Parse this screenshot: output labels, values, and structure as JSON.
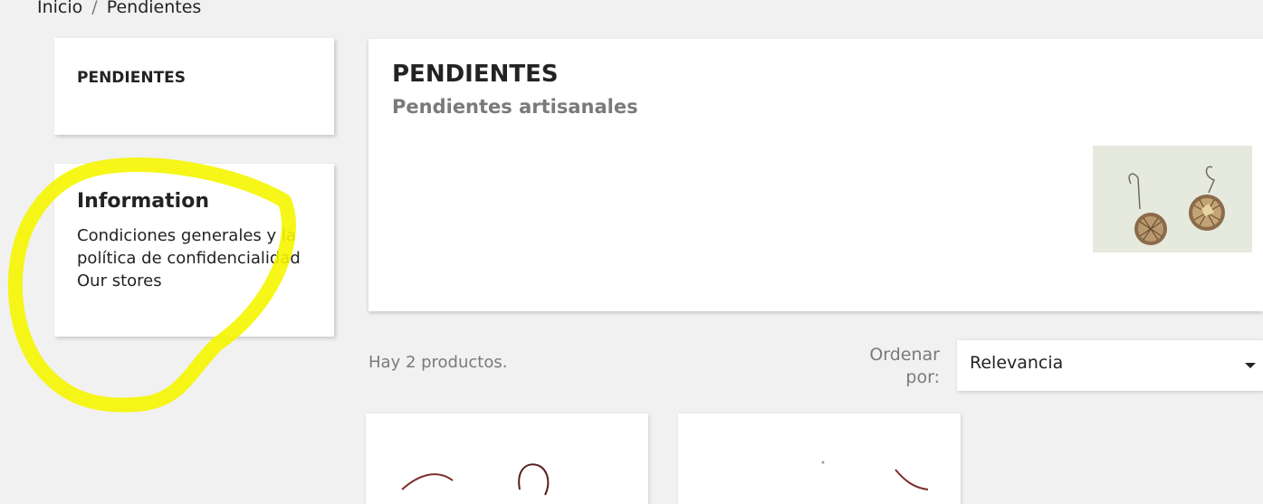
{
  "breadcrumb": {
    "home": "Inicio",
    "separator": "/",
    "current": "Pendientes"
  },
  "sidebar": {
    "category_title": "PENDIENTES",
    "info": {
      "heading": "Information",
      "links": [
        "Condiciones generales y la política de confidencialidad",
        "Our stores"
      ]
    }
  },
  "category": {
    "title": "PENDIENTES",
    "subtitle": "Pendientes artisanales",
    "image_icon": "earrings-image"
  },
  "listing": {
    "count_text": "Hay 2 productos.",
    "sort_label": "Ordenar por:",
    "sort_value": "Relevancia"
  },
  "products": [
    {
      "image_icon": "earring-thumbnail"
    },
    {
      "image_icon": "earring-thumbnail"
    }
  ],
  "colors": {
    "highlight": "#f5f500",
    "background": "#f1f1f1"
  }
}
